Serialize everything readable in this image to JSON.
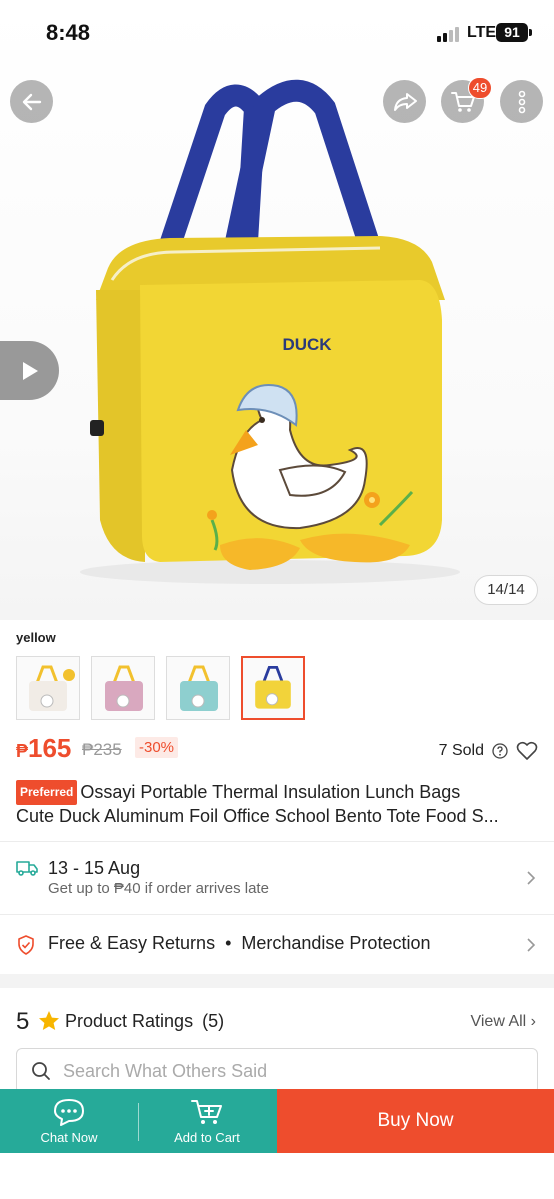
{
  "status_bar": {
    "time": "8:48",
    "network": "LTE",
    "battery": "91"
  },
  "top_nav": {
    "cart_badge": "49"
  },
  "gallery": {
    "counter": "14/14",
    "print_text": "DUCK"
  },
  "variation": {
    "label": "yellow",
    "thumbnail_colors": [
      "#f1ece6",
      "#d9a8bf",
      "#8ecfcf",
      "#f2d33a"
    ],
    "selected_index": 3
  },
  "price": {
    "currency": "₱",
    "current": "165",
    "original": "₱235",
    "discount": "-30%"
  },
  "sold": {
    "text": "7 Sold"
  },
  "title": {
    "badge": "Preferred",
    "line1": "Ossayi Portable Thermal Insulation Lunch Bags",
    "line2": "Cute Duck Aluminum Foil Office School Bento Tote Food S..."
  },
  "shipping": {
    "date": "13 - 15 Aug",
    "guarantee": "Get up to ₱40 if order arrives late"
  },
  "returns": {
    "label": "Free & Easy Returns",
    "separator": "•",
    "protection": "Merchandise Protection"
  },
  "ratings": {
    "score": "5",
    "title": "Product Ratings",
    "count": "(5)",
    "view_all": "View All",
    "search_placeholder": "Search What Others Said"
  },
  "bottom_bar": {
    "chat": "Chat Now",
    "add_to_cart": "Add to Cart",
    "buy_now": "Buy Now"
  },
  "colors": {
    "brand": "#ee4d2d",
    "teal": "#26aa99",
    "bag_yellow": "#f2d634",
    "handle_blue": "#2a3c9e"
  }
}
